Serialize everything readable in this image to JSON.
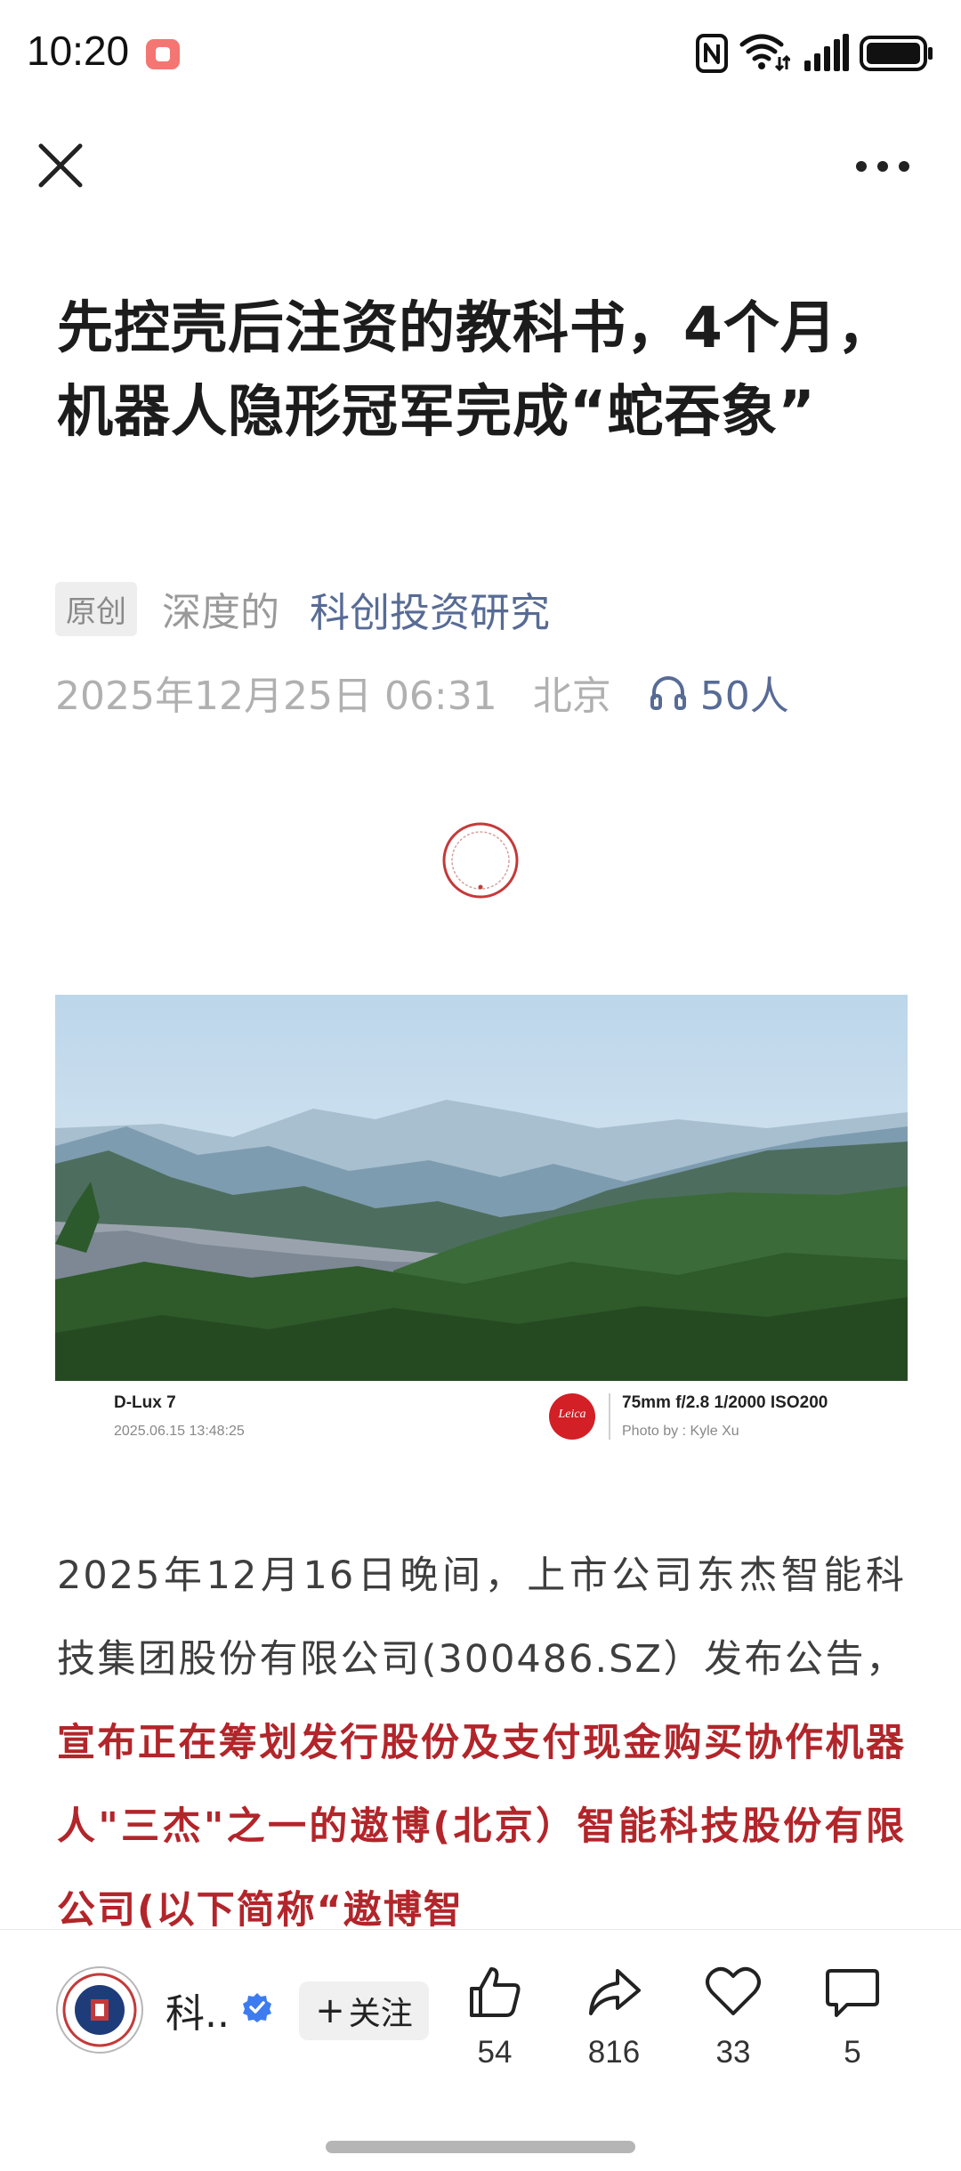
{
  "status_bar": {
    "time": "10:20",
    "icons": [
      "screen-record-icon",
      "nfc-icon",
      "wifi-icon",
      "signal-icon",
      "battery-icon"
    ]
  },
  "nav": {
    "close_icon": "close-icon",
    "more_icon": "more-icon"
  },
  "article": {
    "title": "先控壳后注资的教科书，4个月，机器人隐形冠军完成“蛇吞象”",
    "badge": "原创",
    "author": "深度的",
    "account": "科创投资研究",
    "date": "2025年12月25日 06:31",
    "location": "北京",
    "listen_count": "50人",
    "photo": {
      "camera": "D-Lux 7",
      "date": "2025.06.15 13:48:25",
      "brand": "Leica",
      "lens": "75mm f/2.8 1/2000 ISO200",
      "credit": "Photo by : Kyle Xu"
    },
    "body_plain": "2025年12月16日晚间，上市公司东杰智能科技集团股份有限公司(300486.SZ）发布公告，",
    "body_highlight": "宣布正在筹划发行股份及支付现金购买协作机器人\"三杰\"之一的遨博(北京）智能科技股份有限公司(以下简称“遨博智"
  },
  "bottom_bar": {
    "account_name": "科..",
    "follow_label": "关注",
    "like_count": "54",
    "share_count": "816",
    "favorite_count": "33",
    "comment_count": "5"
  },
  "colors": {
    "link": "#576b95",
    "highlight": "#b2252a",
    "record": "#f47672",
    "verified": "#3d7bf0"
  }
}
